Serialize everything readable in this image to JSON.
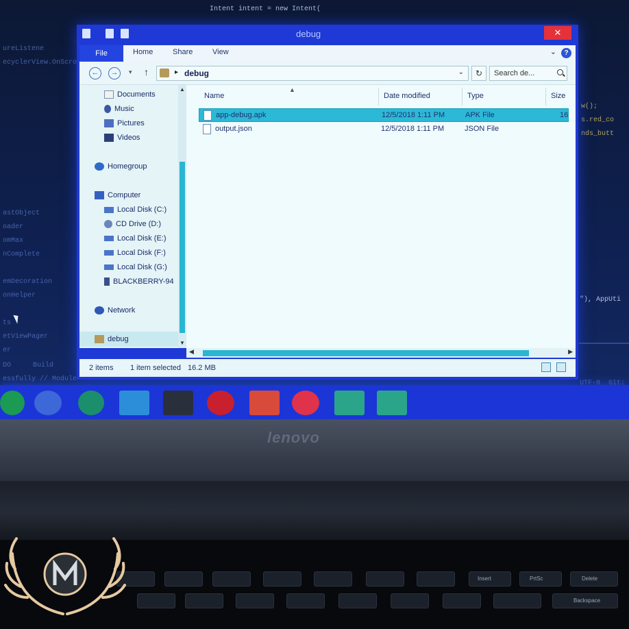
{
  "explorer": {
    "window_title": "debug",
    "close_glyph": "✕",
    "tabs": {
      "file": "File",
      "home": "Home",
      "share": "Share",
      "view": "View"
    },
    "address": {
      "folder": "debug",
      "separator": "▸"
    },
    "search_placeholder": "Search de...",
    "nav": {
      "documents": "Documents",
      "music": "Music",
      "pictures": "Pictures",
      "videos": "Videos",
      "homegroup": "Homegroup",
      "computer": "Computer",
      "drive_c": "Local Disk (C:)",
      "drive_d": "CD Drive (D:)",
      "drive_e": "Local Disk (E:)",
      "drive_f": "Local Disk (F:)",
      "drive_g": "Local Disk (G:)",
      "blackberry": "BLACKBERRY-94",
      "network": "Network",
      "debug": "debug"
    },
    "columns": {
      "name": "Name",
      "date": "Date modified",
      "type": "Type",
      "size": "Size"
    },
    "files": [
      {
        "name": "app-debug.apk",
        "date": "12/5/2018 1:11 PM",
        "type": "APK File",
        "size": "16",
        "selected": true
      },
      {
        "name": "output.json",
        "date": "12/5/2018 1:11 PM",
        "type": "JSON File",
        "size": "",
        "selected": false
      }
    ],
    "status": {
      "items": "2 items",
      "selection": "1 item selected",
      "size": "16.2 MB"
    }
  },
  "ide": {
    "top_line": "Intent intent = new Intent(",
    "left_fragments": [
      "ureListene",
      "ecyclerView.OnScrollListen",
      "astObject",
      "oader",
      "omMax",
      "nComplete",
      "emDecoration",
      "onHelper",
      "ts",
      "etViewPager",
      "er",
      "DO",
      "Build",
      "essfully // Module"
    ],
    "right_fragments": [
      "w();",
      "s.red_co",
      "nds_butt",
      "\"), AppUti",
      "UTF-8  Git:"
    ]
  },
  "laptop": {
    "brand": "lenovo"
  },
  "keyboard": {
    "keys": [
      "Insert",
      "PrtSc",
      "Delete",
      "Backspace"
    ]
  },
  "colors": {
    "window_frame": "#1e39d6",
    "selection": "#2bb9d7",
    "taskbar": "#1c35d6",
    "close": "#e5313a"
  }
}
